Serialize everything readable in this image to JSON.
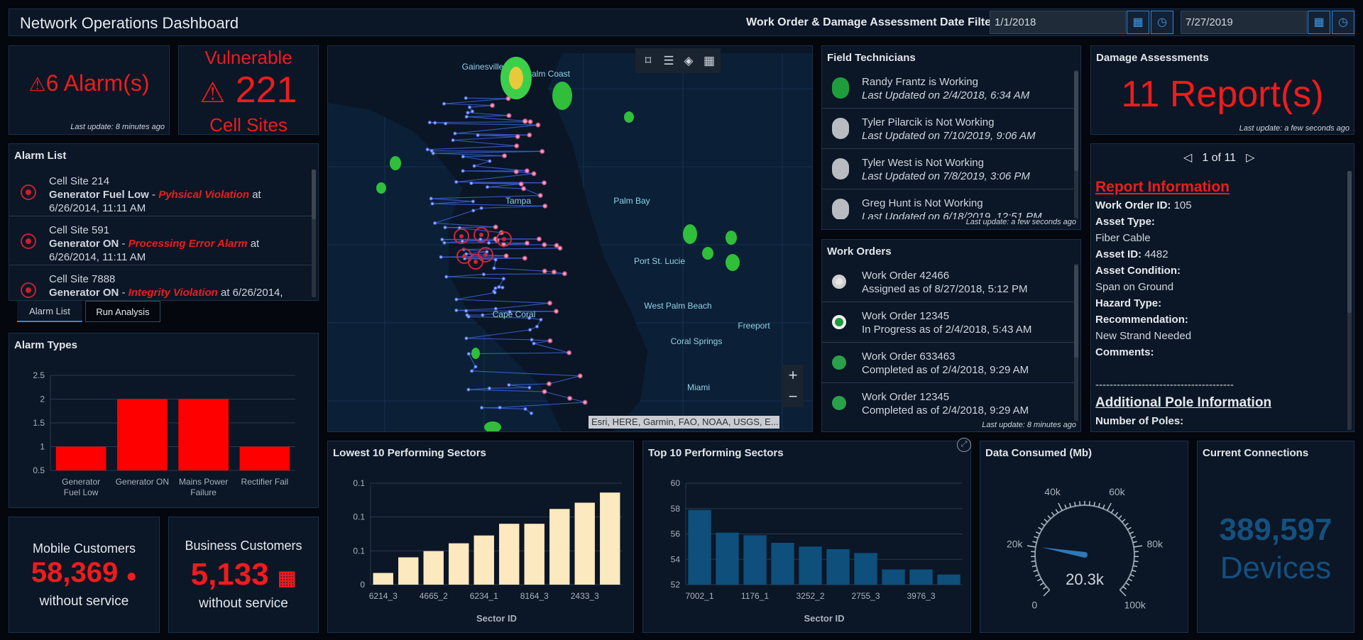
{
  "header": {
    "title": "Network Operations Dashboard",
    "filter_label": "Work Order & Damage Assessment Date Filter",
    "start_date": "1/1/2018",
    "end_date": "7/27/2019"
  },
  "alarms_tile": {
    "value": "6 Alarm(s)",
    "updated": "Last update: 8 minutes ago"
  },
  "vulnerable_tile": {
    "line1": "Vulnerable",
    "value": "221",
    "line2": "Cell Sites"
  },
  "alarm_list": {
    "title": "Alarm List",
    "items": [
      {
        "site": "Cell Site 214",
        "type": "Generator Fuel Low",
        "sep": " - ",
        "issue": "Pyhsical Violation",
        "at": " at 6/26/2014, 11:11 AM"
      },
      {
        "site": "Cell Site 591",
        "type": "Generator ON",
        "sep": " - ",
        "issue": "Processing Error Alarm",
        "at": " at 6/26/2014, 11:11 AM"
      },
      {
        "site": "Cell Site 7888",
        "type": "Generator ON",
        "sep": " - ",
        "issue": "Integrity Violation",
        "at": " at 6/26/2014,"
      }
    ],
    "tabs": [
      "Alarm List",
      "Run Analysis"
    ]
  },
  "alarm_types": {
    "title": "Alarm Types"
  },
  "mobile_customers": {
    "label": "Mobile Customers",
    "value": "58,369",
    "sub": "without service"
  },
  "business_customers": {
    "label": "Business Customers",
    "value": "5,133",
    "sub": "without service"
  },
  "map": {
    "attribution": "Esri, HERE, Garmin, FAO, NOAA, USGS, E...",
    "zoom_in": "+",
    "zoom_out": "−",
    "labels": [
      "Gainesville",
      "Palm Coast",
      "Tampa",
      "Palm Bay",
      "Port St. Lucie",
      "West Palm Beach",
      "Cape Coral",
      "Coral Springs",
      "Miami",
      "Freeport"
    ]
  },
  "field_technicians": {
    "title": "Field Technicians",
    "items": [
      {
        "name": "Randy Frantz is Working",
        "updated": "Last Updated on 2/4/2018, 6:34 AM",
        "status": "working"
      },
      {
        "name": "Tyler Pilarcik is Not Working",
        "updated": "Last Updated on 7/10/2019, 9:06 AM",
        "status": "not-working"
      },
      {
        "name": "Tyler West is Not Working",
        "updated": "Last Updated on 7/8/2019, 3:06 PM",
        "status": "not-working"
      },
      {
        "name": "Greg Hunt is Not Working",
        "updated": "Last Updated on 6/18/2019, 12:51 PM",
        "status": "not-working"
      }
    ],
    "updated": "Last update: a few seconds ago"
  },
  "work_orders": {
    "title": "Work Orders",
    "items": [
      {
        "name": "Work Order 42466",
        "status": "Assigned as of 8/27/2018, 5:12 PM",
        "state": "assigned"
      },
      {
        "name": "Work Order 12345",
        "status": "In Progress as of 2/4/2018, 5:43 AM",
        "state": "in-progress"
      },
      {
        "name": "Work Order 633463",
        "status": "Completed as of 2/4/2018, 9:29 AM",
        "state": "completed"
      },
      {
        "name": "Work Order 12345",
        "status": "Completed as of 2/4/2018, 9:29 AM",
        "state": "completed"
      }
    ],
    "updated": "Last update: 8 minutes ago"
  },
  "damage": {
    "title": "Damage Assessments",
    "value": "11 Report(s)",
    "updated": "Last update: a few seconds ago"
  },
  "report": {
    "pager": "1 of 11",
    "heading": "Report Information",
    "work_order_label": "Work Order ID:",
    "work_order_value": "105",
    "asset_type_label": "Asset Type:",
    "asset_type_value": "Fiber Cable",
    "asset_id_label": "Asset ID:",
    "asset_id_value": "4482",
    "asset_condition_label": "Asset Condition:",
    "asset_condition_value": "Span on Ground",
    "hazard_label": "Hazard Type:",
    "recommendation_label": "Recommendation:",
    "recommendation_value": "New Strand Needed",
    "comments_label": "Comments:",
    "divider": "---------------------------------------",
    "pole_heading": "Additional Pole Information",
    "poles_label": "Number of Poles:"
  },
  "data_consumed": {
    "title": "Data Consumed (Mb)",
    "value": "20.3k",
    "ticks": [
      "0",
      "20k",
      "40k",
      "60k",
      "80k",
      "100k"
    ],
    "reading": 20300,
    "max": 100000
  },
  "connections": {
    "title": "Current Connections",
    "value": "389,597",
    "unit": "Devices"
  },
  "charts": {
    "lowest": {
      "title": "Lowest 10 Performing Sectors"
    },
    "top": {
      "title": "Top 10 Performing Sectors"
    }
  },
  "chart_data": [
    {
      "type": "bar",
      "title": "Alarm Types",
      "categories": [
        "Generator Fuel Low",
        "Generator ON",
        "Mains Power Failure",
        "Rectifier Fail"
      ],
      "values": [
        1,
        2,
        2,
        1
      ],
      "ylim": [
        0.5,
        2.5
      ],
      "yticks": [
        "0.5",
        "1",
        "1.5",
        "2",
        "2.5"
      ],
      "xlabel": "",
      "ylabel": "",
      "color": "#ff0000"
    },
    {
      "type": "bar",
      "title": "Lowest 10 Performing Sectors",
      "categories": [
        "6214_3",
        "",
        "4665_2",
        "",
        "6234_1",
        "",
        "8164_3",
        "",
        "2433_3",
        ""
      ],
      "values": [
        0.015,
        0.035,
        0.043,
        0.053,
        0.063,
        0.078,
        0.078,
        0.097,
        0.105,
        0.118
      ],
      "ylim": [
        0,
        0.13
      ],
      "yticks": [
        "0",
        "0.1",
        "0.1",
        "0.1"
      ],
      "xlabel": "Sector ID",
      "ylabel": "",
      "color": "#fde9bf"
    },
    {
      "type": "bar",
      "title": "Top 10 Performing Sectors",
      "categories": [
        "7002_1",
        "",
        "1176_1",
        "",
        "3252_2",
        "",
        "2755_3",
        "",
        "3976_3",
        ""
      ],
      "values": [
        57.9,
        56.1,
        55.9,
        55.3,
        55.0,
        54.8,
        54.5,
        53.2,
        53.2,
        52.8
      ],
      "ylim": [
        52,
        60
      ],
      "yticks": [
        "52",
        "54",
        "56",
        "58",
        "60"
      ],
      "xlabel": "Sector ID",
      "ylabel": "",
      "color": "#0e4f7c"
    }
  ]
}
